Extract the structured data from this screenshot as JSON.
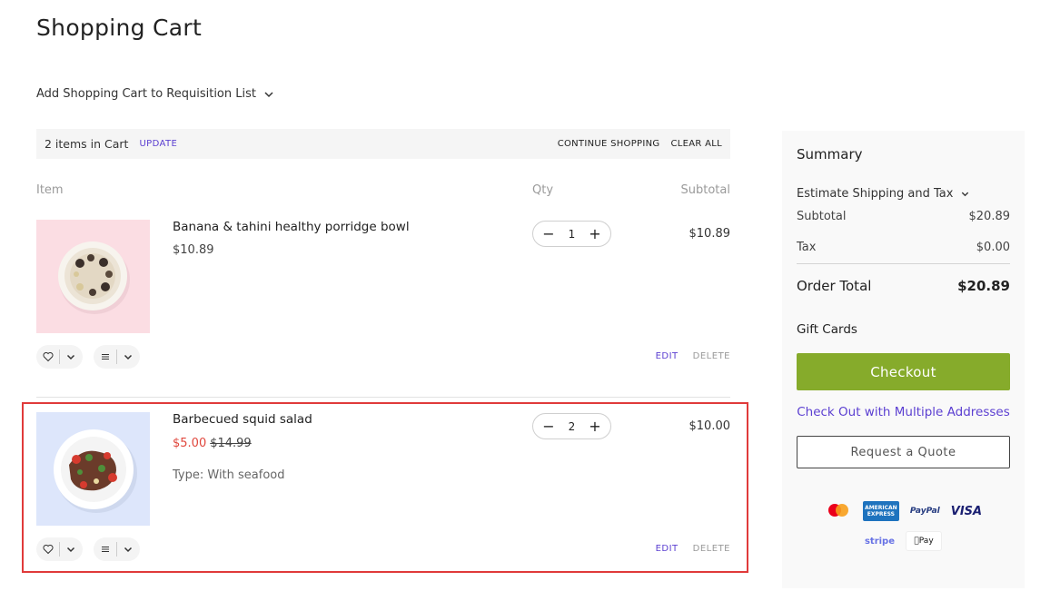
{
  "page": {
    "title": "Shopping Cart"
  },
  "requisition": {
    "label": "Add Shopping Cart to Requisition List"
  },
  "cart_bar": {
    "count": "2 items in Cart",
    "update": "UPDATE",
    "continue": "CONTINUE SHOPPING",
    "clear": "CLEAR ALL"
  },
  "columns": {
    "item": "Item",
    "qty": "Qty",
    "subtotal": "Subtotal"
  },
  "items": [
    {
      "name": "Banana & tahini healthy porridge bowl",
      "price": "$10.89",
      "qty": "1",
      "subtotal": "$10.89",
      "edit": "EDIT",
      "delete": "DELETE",
      "image_bg": "#fbdde3"
    },
    {
      "name": "Barbecued squid salad",
      "sale_price": "$5.00",
      "old_price": "$14.99",
      "option": "Type: With seafood",
      "qty": "2",
      "subtotal": "$10.00",
      "edit": "EDIT",
      "delete": "DELETE",
      "image_bg": "#dde6fb"
    }
  ],
  "summary": {
    "title": "Summary",
    "estimate": "Estimate Shipping and Tax",
    "subtotal_label": "Subtotal",
    "subtotal_value": "$20.89",
    "tax_label": "Tax",
    "tax_value": "$0.00",
    "total_label": "Order Total",
    "total_value": "$20.89",
    "gift_cards": "Gift Cards",
    "checkout": "Checkout",
    "multi_address": "Check Out with Multiple Addresses",
    "quote": "Request a Quote",
    "payments": {
      "amex": "AMERICAN EXPRESS",
      "paypal": "PayPal",
      "visa": "VISA",
      "stripe": "stripe",
      "apple": "Pay"
    }
  },
  "colors": {
    "accent": "#5b3fd1",
    "checkout": "#86ab2b",
    "sale": "#e0463c",
    "highlight": "#e03a3a"
  }
}
